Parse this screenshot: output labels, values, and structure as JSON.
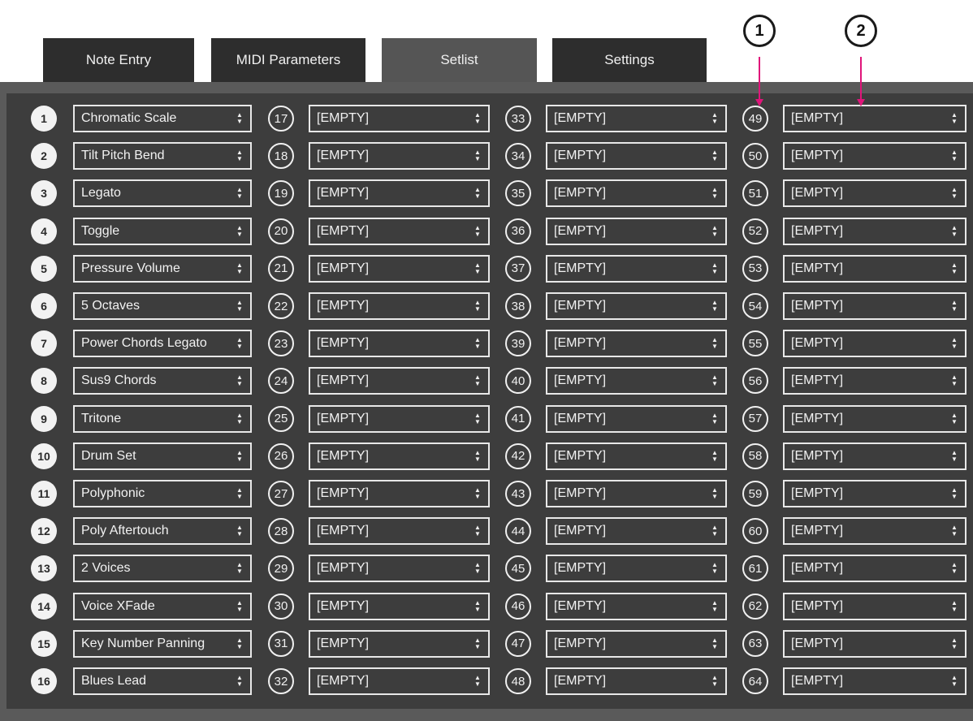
{
  "tabs": [
    {
      "label": "Note Entry",
      "active": false
    },
    {
      "label": "MIDI Parameters",
      "active": false
    },
    {
      "label": "Setlist",
      "active": true
    },
    {
      "label": "Settings",
      "active": false
    }
  ],
  "callouts": [
    "1",
    "2"
  ],
  "colors": {
    "callout_arrow": "#e0157a",
    "panel_bg": "#3d3d3d",
    "tab_bg": "#2d2d2d",
    "tab_active_bg": "#555555"
  },
  "slot_icon": "up-down-chevron-icon",
  "slots": [
    {
      "number": "1",
      "preset": "Chromatic Scale"
    },
    {
      "number": "2",
      "preset": "Tilt Pitch Bend"
    },
    {
      "number": "3",
      "preset": "Legato"
    },
    {
      "number": "4",
      "preset": "Toggle"
    },
    {
      "number": "5",
      "preset": "Pressure Volume"
    },
    {
      "number": "6",
      "preset": "5 Octaves"
    },
    {
      "number": "7",
      "preset": "Power Chords Legato"
    },
    {
      "number": "8",
      "preset": "Sus9 Chords"
    },
    {
      "number": "9",
      "preset": "Tritone"
    },
    {
      "number": "10",
      "preset": "Drum Set"
    },
    {
      "number": "11",
      "preset": "Polyphonic"
    },
    {
      "number": "12",
      "preset": "Poly Aftertouch"
    },
    {
      "number": "13",
      "preset": "2 Voices"
    },
    {
      "number": "14",
      "preset": "Voice XFade"
    },
    {
      "number": "15",
      "preset": "Key Number Panning"
    },
    {
      "number": "16",
      "preset": "Blues Lead"
    },
    {
      "number": "17",
      "preset": "[EMPTY]"
    },
    {
      "number": "18",
      "preset": "[EMPTY]"
    },
    {
      "number": "19",
      "preset": "[EMPTY]"
    },
    {
      "number": "20",
      "preset": "[EMPTY]"
    },
    {
      "number": "21",
      "preset": "[EMPTY]"
    },
    {
      "number": "22",
      "preset": "[EMPTY]"
    },
    {
      "number": "23",
      "preset": "[EMPTY]"
    },
    {
      "number": "24",
      "preset": "[EMPTY]"
    },
    {
      "number": "25",
      "preset": "[EMPTY]"
    },
    {
      "number": "26",
      "preset": "[EMPTY]"
    },
    {
      "number": "27",
      "preset": "[EMPTY]"
    },
    {
      "number": "28",
      "preset": "[EMPTY]"
    },
    {
      "number": "29",
      "preset": "[EMPTY]"
    },
    {
      "number": "30",
      "preset": "[EMPTY]"
    },
    {
      "number": "31",
      "preset": "[EMPTY]"
    },
    {
      "number": "32",
      "preset": "[EMPTY]"
    },
    {
      "number": "33",
      "preset": "[EMPTY]"
    },
    {
      "number": "34",
      "preset": "[EMPTY]"
    },
    {
      "number": "35",
      "preset": "[EMPTY]"
    },
    {
      "number": "36",
      "preset": "[EMPTY]"
    },
    {
      "number": "37",
      "preset": "[EMPTY]"
    },
    {
      "number": "38",
      "preset": "[EMPTY]"
    },
    {
      "number": "39",
      "preset": "[EMPTY]"
    },
    {
      "number": "40",
      "preset": "[EMPTY]"
    },
    {
      "number": "41",
      "preset": "[EMPTY]"
    },
    {
      "number": "42",
      "preset": "[EMPTY]"
    },
    {
      "number": "43",
      "preset": "[EMPTY]"
    },
    {
      "number": "44",
      "preset": "[EMPTY]"
    },
    {
      "number": "45",
      "preset": "[EMPTY]"
    },
    {
      "number": "46",
      "preset": "[EMPTY]"
    },
    {
      "number": "47",
      "preset": "[EMPTY]"
    },
    {
      "number": "48",
      "preset": "[EMPTY]"
    },
    {
      "number": "49",
      "preset": "[EMPTY]"
    },
    {
      "number": "50",
      "preset": "[EMPTY]"
    },
    {
      "number": "51",
      "preset": "[EMPTY]"
    },
    {
      "number": "52",
      "preset": "[EMPTY]"
    },
    {
      "number": "53",
      "preset": "[EMPTY]"
    },
    {
      "number": "54",
      "preset": "[EMPTY]"
    },
    {
      "number": "55",
      "preset": "[EMPTY]"
    },
    {
      "number": "56",
      "preset": "[EMPTY]"
    },
    {
      "number": "57",
      "preset": "[EMPTY]"
    },
    {
      "number": "58",
      "preset": "[EMPTY]"
    },
    {
      "number": "59",
      "preset": "[EMPTY]"
    },
    {
      "number": "60",
      "preset": "[EMPTY]"
    },
    {
      "number": "61",
      "preset": "[EMPTY]"
    },
    {
      "number": "62",
      "preset": "[EMPTY]"
    },
    {
      "number": "63",
      "preset": "[EMPTY]"
    },
    {
      "number": "64",
      "preset": "[EMPTY]"
    }
  ]
}
